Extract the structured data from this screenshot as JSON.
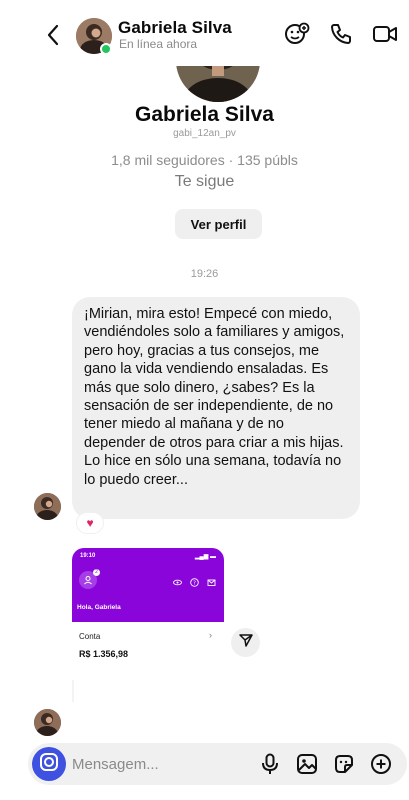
{
  "header": {
    "contact_name": "Gabriela Silva",
    "status": "En línea ahora",
    "icons": [
      "back-chevron-icon",
      "sticker-icon",
      "phone-icon",
      "video-icon"
    ]
  },
  "profile": {
    "name": "Gabriela Silva",
    "handle": "gabi_12an_pv",
    "stats": "1,8 mil seguidores · 135 públs",
    "follows_you": "Te sigue",
    "view_profile_label": "Ver perfil"
  },
  "conversation": {
    "timestamp": "19:26",
    "message_text": "¡Mirian, mira esto! Empecé con miedo, vendiéndoles solo a familiares y amigos, pero hoy, gracias a tus consejos, me gano la vida vendiendo ensaladas. Es más que solo dinero, ¿sabes? Es la sensación de ser independiente, de no tener miedo al mañana y de no depender de otros para criar a mis hijas.\nLo hice en sólo una semana, todavía no lo puedo creer...",
    "reaction": "♥",
    "shared_image": {
      "status_time": "19:10",
      "notification_count": "2",
      "greeting": "Hola, Gabriela",
      "account_label": "Conta",
      "arrow": "›",
      "balance": "R$ 1.356,98"
    }
  },
  "composer": {
    "placeholder": "Mensagem...",
    "icons": [
      "camera-icon",
      "microphone-icon",
      "image-icon",
      "sticker-icon",
      "plus-icon"
    ]
  },
  "colors": {
    "accent": "#3f51e0",
    "bubble": "#efefef",
    "online": "#22c55e",
    "bank_purple": "#8a05d9"
  }
}
